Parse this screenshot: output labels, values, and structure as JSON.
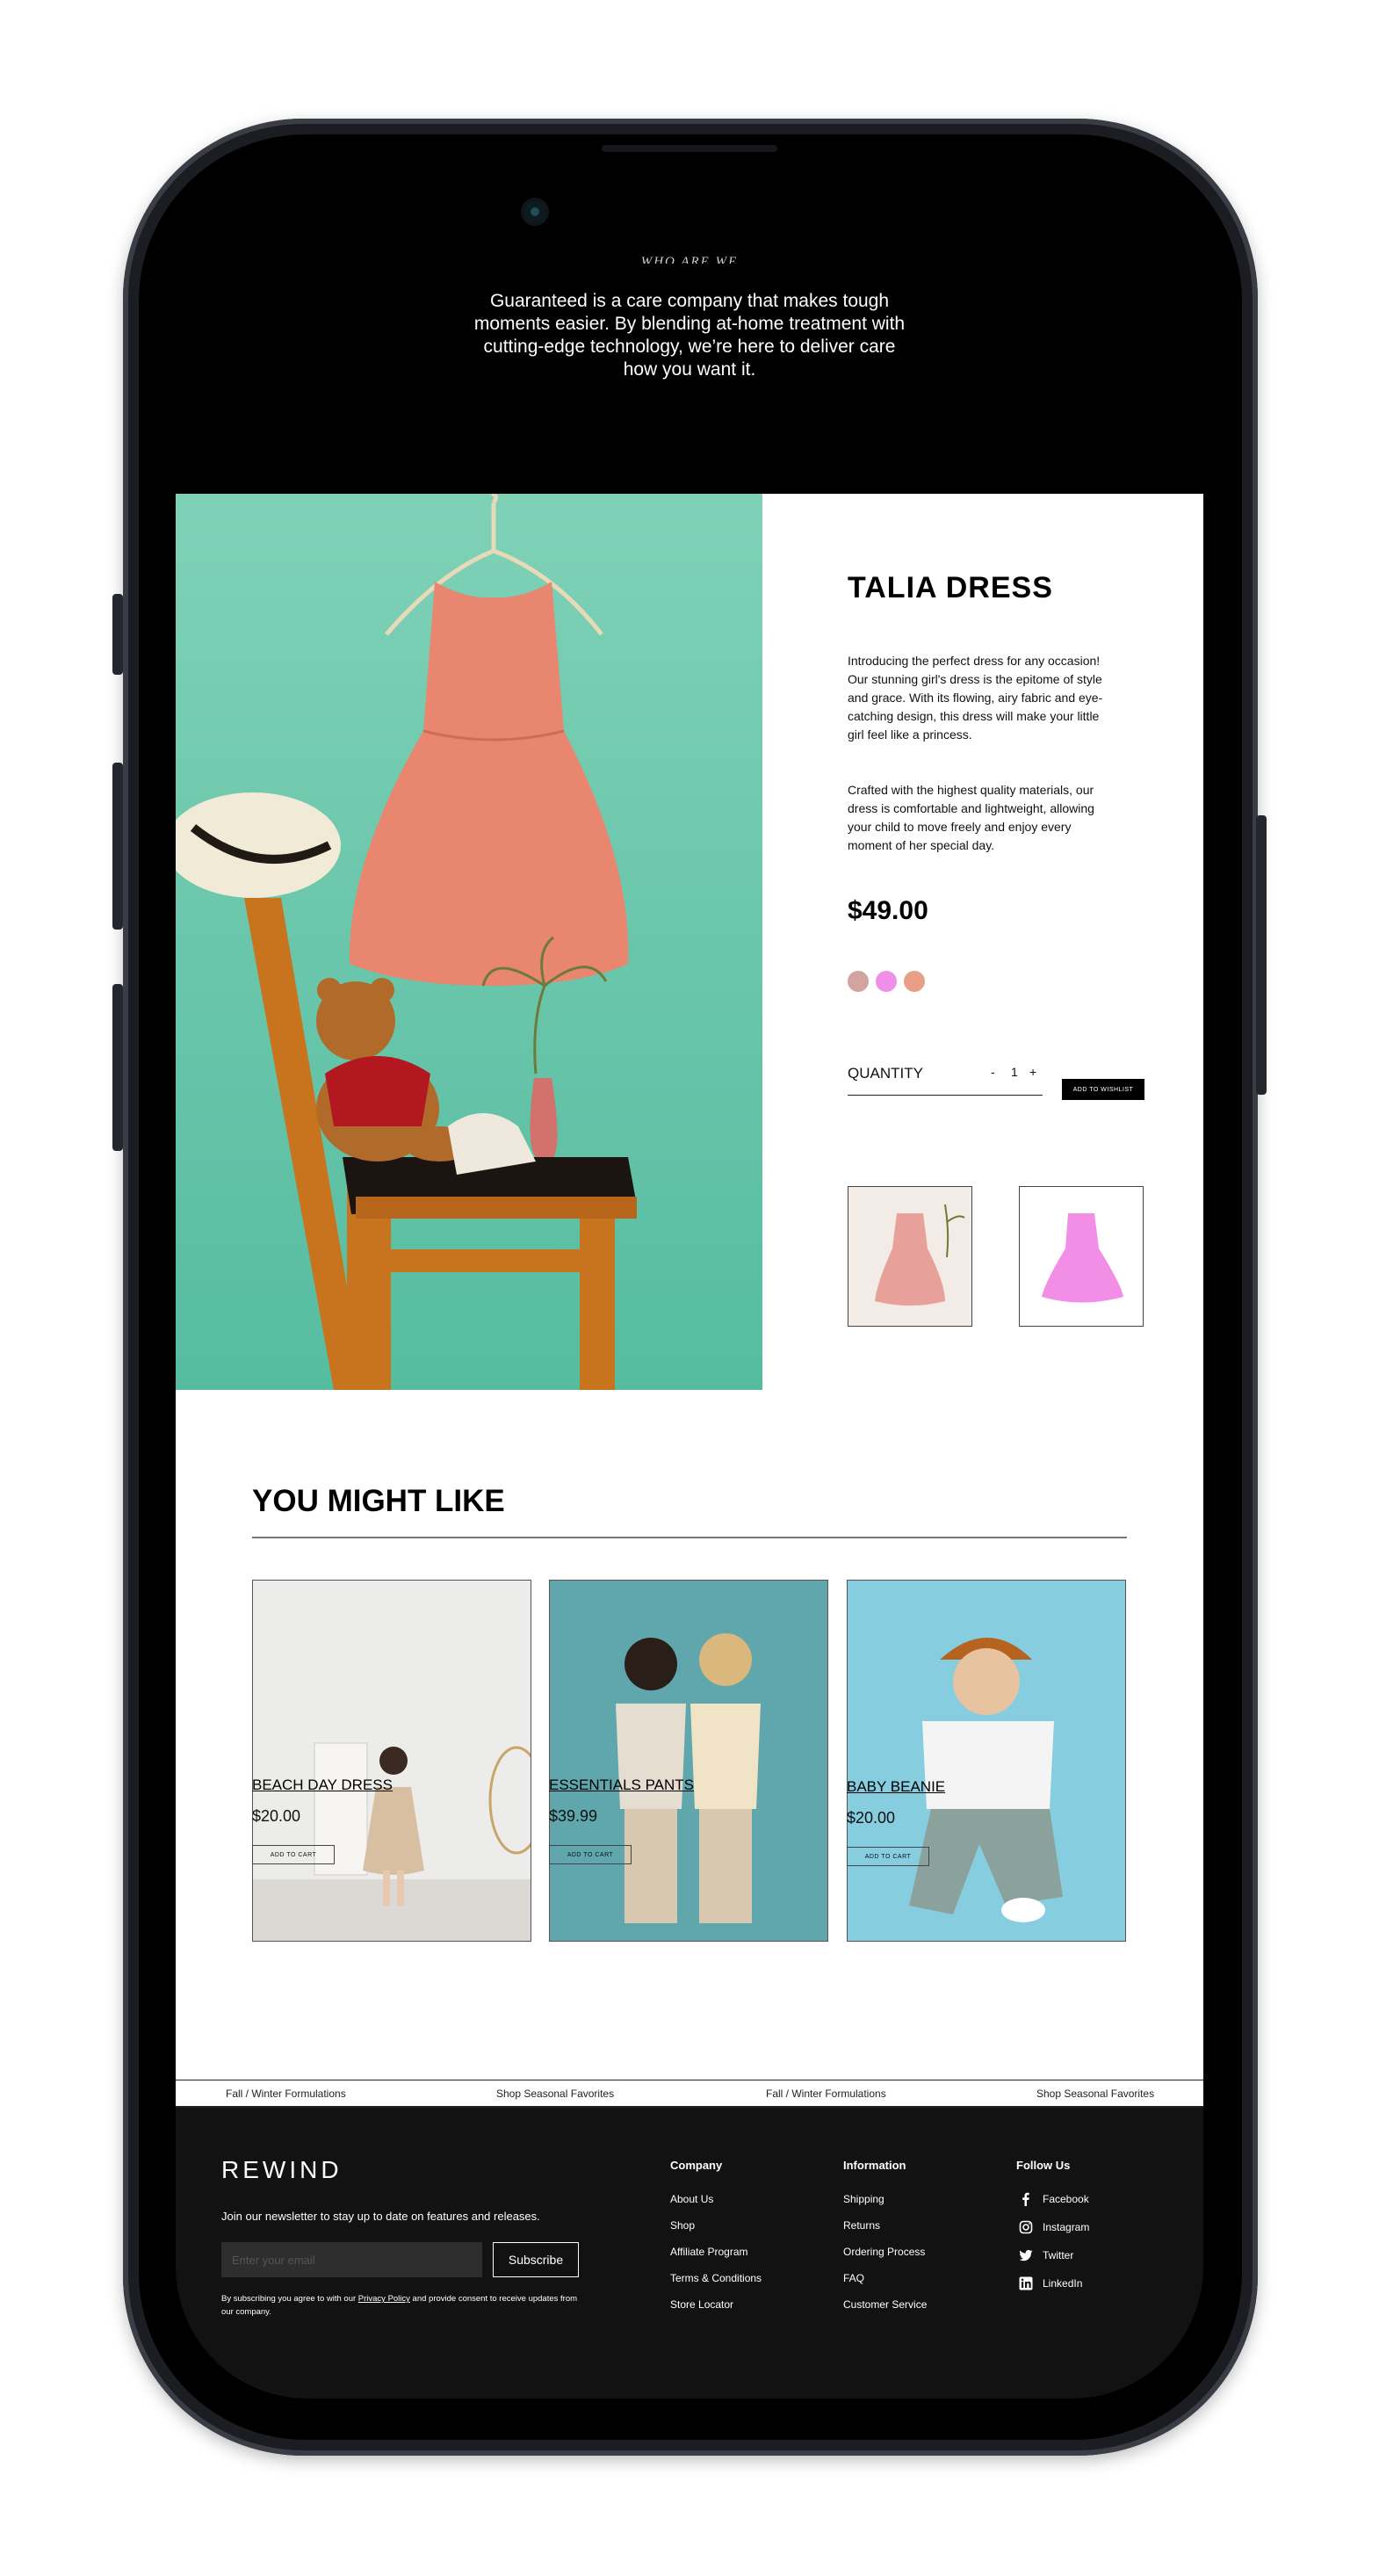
{
  "hero": {
    "eyebrow": "WHO ARE WE",
    "text": "Guaranteed is a care company that makes tough moments easier. By blending at-home treatment with cutting-edge technology, we’re here to deliver care how you want it."
  },
  "product": {
    "title": "TALIA DRESS",
    "description_1": "Introducing the perfect dress for any occasion! Our stunning girl's dress is the epitome of style and grace. With its flowing, airy fabric and eye-catching design, this dress will make your little girl feel like a princess.",
    "description_2": "Crafted with the highest quality materials, our dress is comfortable and lightweight, allowing your child to move freely and enjoy every moment of her special day.",
    "price": "$49.00",
    "colors": [
      "#d3a3a0",
      "#f08ee9",
      "#e99f86"
    ],
    "quantity_label": "QUANTITY",
    "quantity_minus": "-",
    "quantity_value": "1",
    "quantity_plus": "+",
    "wishlist_label": "ADD TO WISHLIST"
  },
  "recommendations": {
    "title": "YOU MIGHT LIKE",
    "items": [
      {
        "name": "BEACH DAY DRESS",
        "price": "$20.00",
        "button": "ADD TO CART"
      },
      {
        "name": "ESSENTIALS PANTS",
        "price": "$39.99",
        "button": "ADD TO CART"
      },
      {
        "name": "BABY BEANIE",
        "price": "$20.00",
        "button": "ADD TO CART"
      }
    ]
  },
  "ticker": [
    "Fall / Winter Formulations",
    "Shop Seasonal Favorites",
    "Fall / Winter Formulations",
    "Shop Seasonal Favorites"
  ],
  "footer": {
    "logo": "REWIND",
    "newsletter": "Join our newsletter to stay up to date on features and releases.",
    "email_placeholder": "Enter your email",
    "subscribe": "Subscribe",
    "consent_prefix": "By subscribing you agree to with our ",
    "consent_link": "Privacy Policy",
    "consent_suffix": " and provide consent to receive updates from our company.",
    "company": {
      "heading": "Company",
      "links": [
        "About Us",
        "Shop",
        "Affiliate Program",
        "Terms & Conditions",
        "Store Locator"
      ]
    },
    "information": {
      "heading": "Information",
      "links": [
        "Shipping",
        "Returns",
        "Ordering Process",
        "FAQ",
        "Customer Service"
      ]
    },
    "follow": {
      "heading": "Follow Us",
      "links": [
        "Facebook",
        "Instagram",
        "Twitter",
        "LinkedIn"
      ],
      "icons": [
        "facebook-icon",
        "instagram-icon",
        "twitter-icon",
        "linkedin-icon"
      ]
    }
  }
}
